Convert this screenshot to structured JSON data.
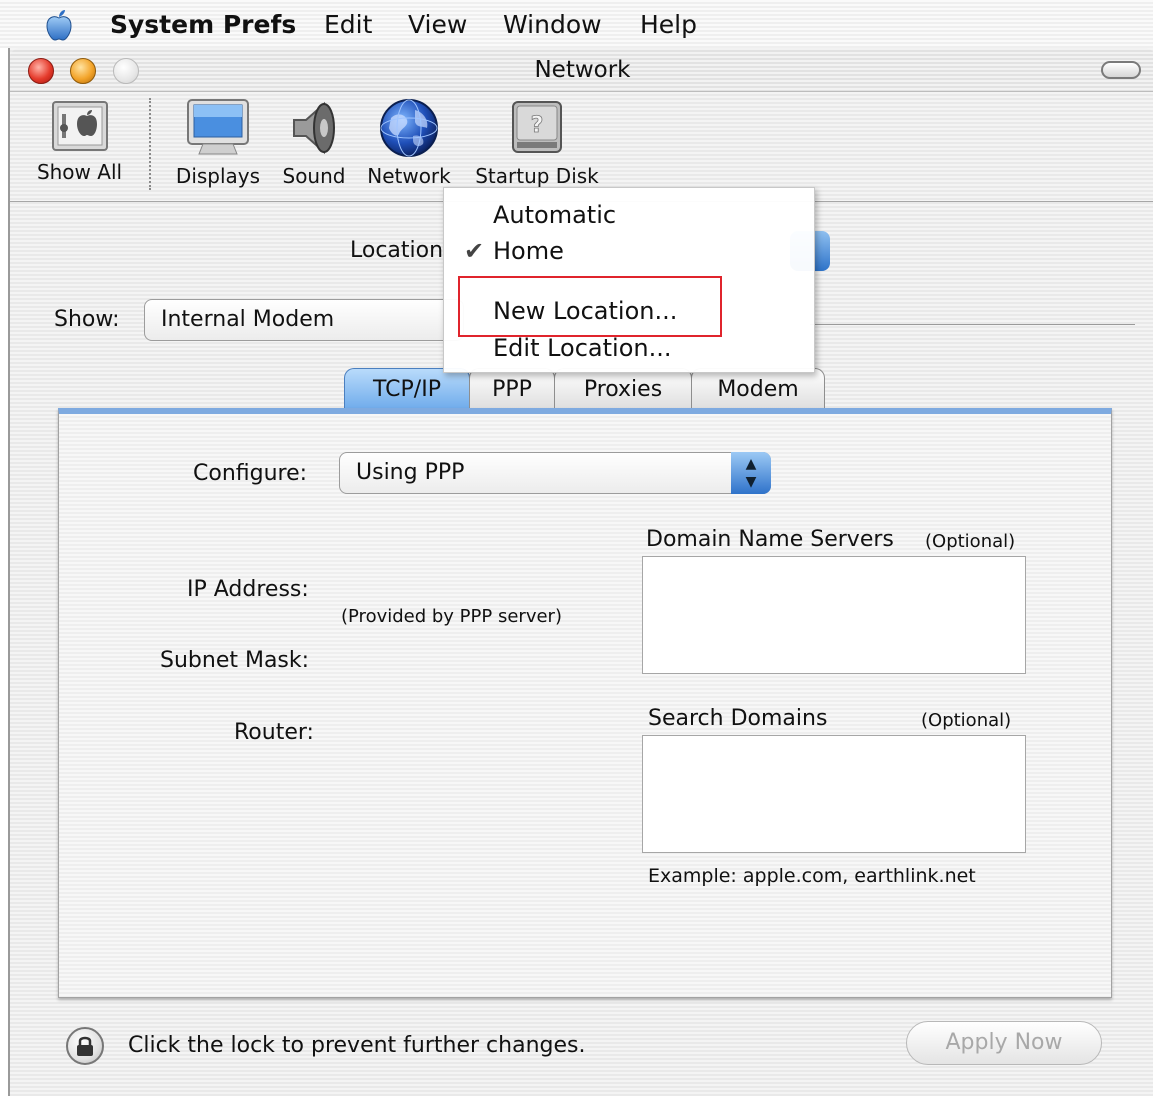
{
  "menubar": {
    "app_name": "System Prefs",
    "items": [
      "Edit",
      "View",
      "Window",
      "Help"
    ]
  },
  "window": {
    "title": "Network"
  },
  "toolbar": {
    "items": [
      {
        "label": "Show All",
        "icon": "show-all-icon"
      },
      {
        "label": "Displays",
        "icon": "displays-icon"
      },
      {
        "label": "Sound",
        "icon": "speaker-icon"
      },
      {
        "label": "Network",
        "icon": "globe-icon"
      },
      {
        "label": "Startup Disk",
        "icon": "hard-disk-icon"
      }
    ]
  },
  "location": {
    "label": "Location",
    "selected": "Home",
    "menu": {
      "items": [
        "Automatic",
        "Home",
        "New Location...",
        "Edit Location..."
      ],
      "checked_item": "Home",
      "highlighted_item": "New Location..."
    }
  },
  "show": {
    "label": "Show:",
    "value": "Internal Modem"
  },
  "tabs": {
    "items": [
      "TCP/IP",
      "PPP",
      "Proxies",
      "Modem"
    ],
    "active": "TCP/IP"
  },
  "tcpip": {
    "configure_label": "Configure:",
    "configure_value": "Using PPP",
    "ip_label": "IP Address:",
    "provided_note": "(Provided by PPP server)",
    "subnet_label": "Subnet Mask:",
    "router_label": "Router:",
    "dns_label": "Domain Name Servers",
    "dns_optional": "(Optional)",
    "dns_value": "",
    "search_label": "Search Domains",
    "search_optional": "(Optional)",
    "search_value": "",
    "example": "Example: apple.com, earthlink.net"
  },
  "footer": {
    "lock_text": "Click the lock to prevent further changes.",
    "apply_label": "Apply Now",
    "apply_enabled": false
  },
  "colors": {
    "accent_blue": "#6aa8ea",
    "highlight_red": "#e0242c",
    "close_red": "#e53b2c",
    "minimize_amber": "#f3a42a"
  }
}
